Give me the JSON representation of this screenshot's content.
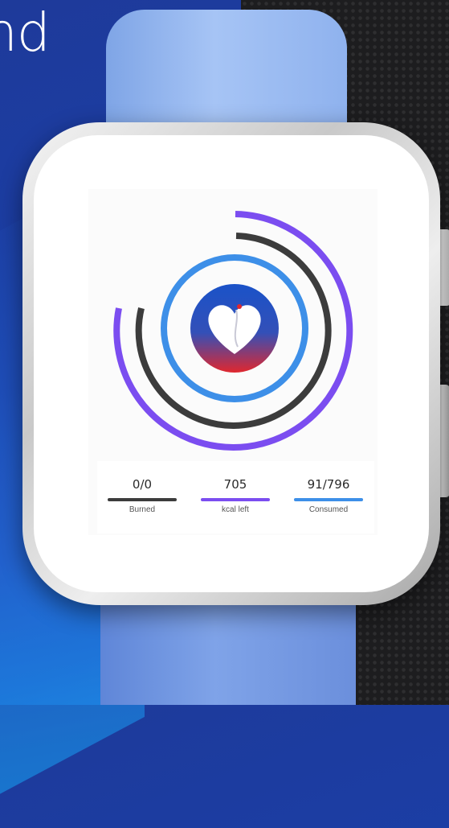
{
  "background": {
    "heading_fragment": "nd"
  },
  "app": {
    "logo": "heart-logo",
    "stats": [
      {
        "value": "0/0",
        "label": "Burned",
        "color": "#3c3c3c"
      },
      {
        "value": "705",
        "label": "kcal left",
        "color": "#7b4df0"
      },
      {
        "value": "91/796",
        "label": "Consumed",
        "color": "#3d8fe8"
      }
    ],
    "colors": {
      "burned": "#3c3c3c",
      "kcal_left": "#7b4df0",
      "consumed": "#3d8fe8",
      "logo_top": "#1a52c8",
      "logo_bottom": "#e0272e"
    }
  }
}
